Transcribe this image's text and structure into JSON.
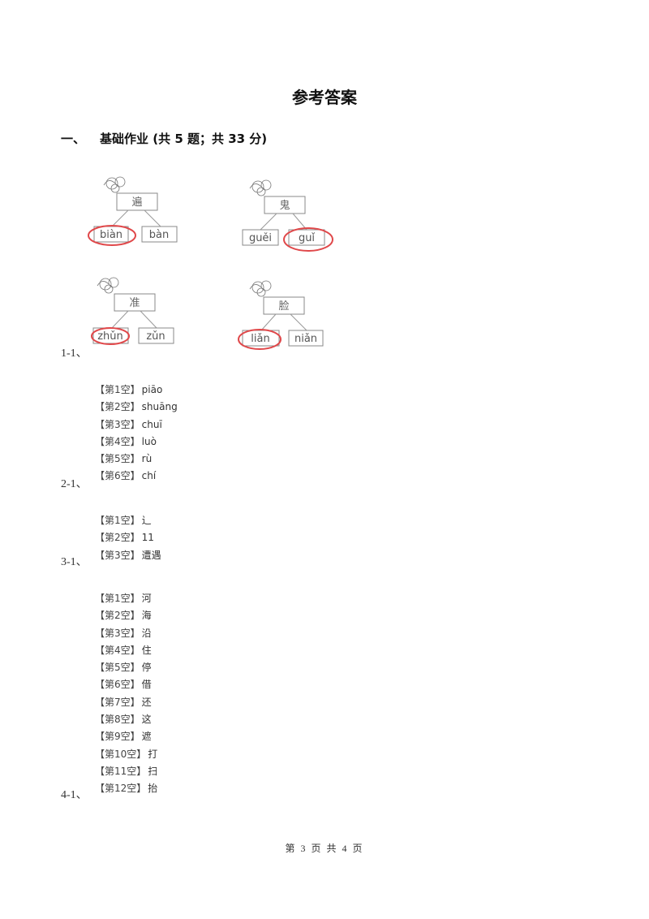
{
  "title": "参考答案",
  "section": {
    "number": "一、",
    "heading": "基础作业 (共 5 题；共 33 分)"
  },
  "diagrams": [
    {
      "char": "遍",
      "options": [
        "biàn",
        "bàn"
      ],
      "correct_index": 0
    },
    {
      "char": "鬼",
      "options": [
        "guěi",
        "guǐ"
      ],
      "correct_index": 1
    },
    {
      "char": "准",
      "options": [
        "zhǔn",
        "zǔn"
      ],
      "correct_index": 0
    },
    {
      "char": "脸",
      "options": [
        "liǎn",
        "niǎn"
      ],
      "correct_index": 0
    }
  ],
  "questions": [
    {
      "label": "1-1、"
    },
    {
      "label": "2-1、",
      "answers": [
        {
          "tag": "【第1空】",
          "value": "piāo"
        },
        {
          "tag": "【第2空】",
          "value": "shuāng"
        },
        {
          "tag": "【第3空】",
          "value": "chuī"
        },
        {
          "tag": "【第4空】",
          "value": "luò"
        },
        {
          "tag": "【第5空】",
          "value": "rù"
        },
        {
          "tag": "【第6空】",
          "value": "chí"
        }
      ]
    },
    {
      "label": "3-1、",
      "answers": [
        {
          "tag": "【第1空】",
          "value": "辶"
        },
        {
          "tag": "【第2空】",
          "value": "11"
        },
        {
          "tag": "【第3空】",
          "value": "遭遇"
        }
      ]
    },
    {
      "label": "4-1、",
      "answers": [
        {
          "tag": "【第1空】",
          "value": "河"
        },
        {
          "tag": "【第2空】",
          "value": "海"
        },
        {
          "tag": "【第3空】",
          "value": "沿"
        },
        {
          "tag": "【第4空】",
          "value": "住"
        },
        {
          "tag": "【第5空】",
          "value": "停"
        },
        {
          "tag": "【第6空】",
          "value": "借"
        },
        {
          "tag": "【第7空】",
          "value": "还"
        },
        {
          "tag": "【第8空】",
          "value": "这"
        },
        {
          "tag": "【第9空】",
          "value": "遮"
        },
        {
          "tag": "【第10空】",
          "value": "打"
        },
        {
          "tag": "【第11空】",
          "value": "扫"
        },
        {
          "tag": "【第12空】",
          "value": "抬"
        }
      ]
    }
  ],
  "footer": "第 3 页 共 4 页"
}
